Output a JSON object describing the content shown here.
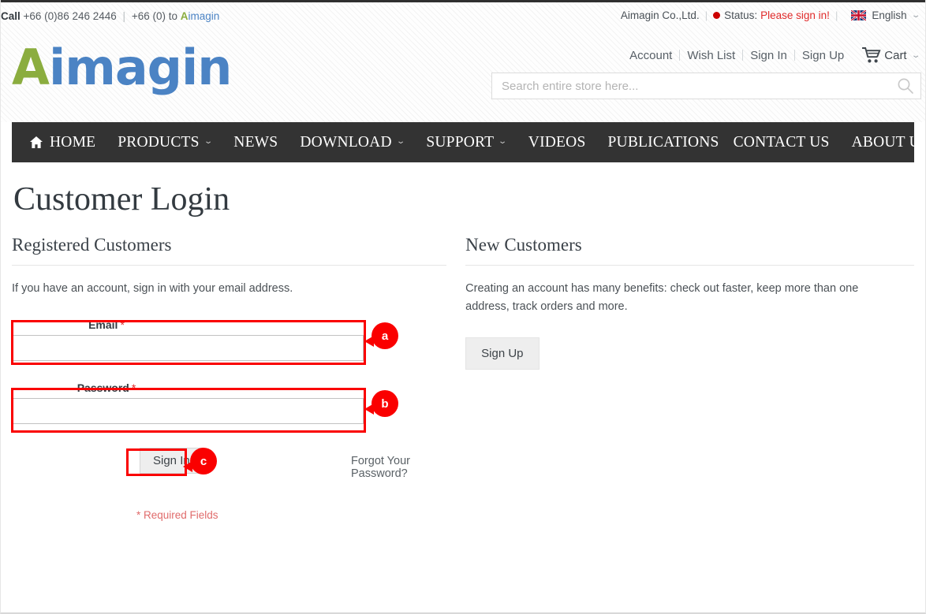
{
  "topbar": {
    "call_label": "Call",
    "phone_primary": "+66 (0)86 246 2446",
    "separator": "|",
    "phone_secondary": "+66 (0) to",
    "brand_a": "A",
    "brand_rest": "imagin",
    "company": "Aimagin Co.,Ltd.",
    "status_label": "Status:",
    "status_value": "Please sign in!",
    "status_color": "#e02b2b",
    "language": "English",
    "language_icon": "uk-flag-icon",
    "chevron_icon": "chevron-down-icon"
  },
  "account_links": [
    {
      "label": "Account"
    },
    {
      "label": "Wish List"
    },
    {
      "label": "Sign In"
    },
    {
      "label": "Sign Up"
    }
  ],
  "cart": {
    "label": "Cart",
    "icon": "shopping-cart-icon",
    "chevron_icon": "chevron-down-icon"
  },
  "logo": {
    "first_letter": "A",
    "rest": "imagin",
    "color_a": "#8bad3f",
    "color_rest": "#4b83c4"
  },
  "search": {
    "placeholder": "Search entire store here...",
    "value": "",
    "icon": "search-icon"
  },
  "nav": {
    "home_icon": "home-icon",
    "left_items": [
      {
        "label": "HOME",
        "caret": false,
        "icon": "home-icon"
      },
      {
        "label": "PRODUCTS",
        "caret": true
      },
      {
        "label": "NEWS",
        "caret": false
      },
      {
        "label": "DOWNLOAD",
        "caret": true
      },
      {
        "label": "SUPPORT",
        "caret": true
      },
      {
        "label": "VIDEOS",
        "caret": false
      },
      {
        "label": "PUBLICATIONS",
        "caret": false
      }
    ],
    "right_items": [
      {
        "label": "CONTACT US",
        "caret": false
      },
      {
        "label": "ABOUT US",
        "caret": false
      }
    ],
    "background": "#333333"
  },
  "page": {
    "title": "Customer Login"
  },
  "registered": {
    "heading": "Registered Customers",
    "note": "If you have an account, sign in with your email address.",
    "email": {
      "label": "Email",
      "required_mark": "*",
      "value": "",
      "placeholder": ""
    },
    "password": {
      "label": "Password",
      "required_mark": "*",
      "value": "",
      "placeholder": ""
    },
    "signin_label": "Sign In",
    "forgot_label": "Forgot Your Password?",
    "required_note": "* Required Fields"
  },
  "new_customers": {
    "heading": "New Customers",
    "note": "Creating an account has many benefits: check out faster, keep more than one address, track orders and more.",
    "signup_label": "Sign Up"
  },
  "annotations": {
    "color": "#fa0000",
    "items": [
      {
        "key": "a",
        "target": "email-field"
      },
      {
        "key": "b",
        "target": "password-field"
      },
      {
        "key": "c",
        "target": "sign-in-button"
      }
    ]
  }
}
